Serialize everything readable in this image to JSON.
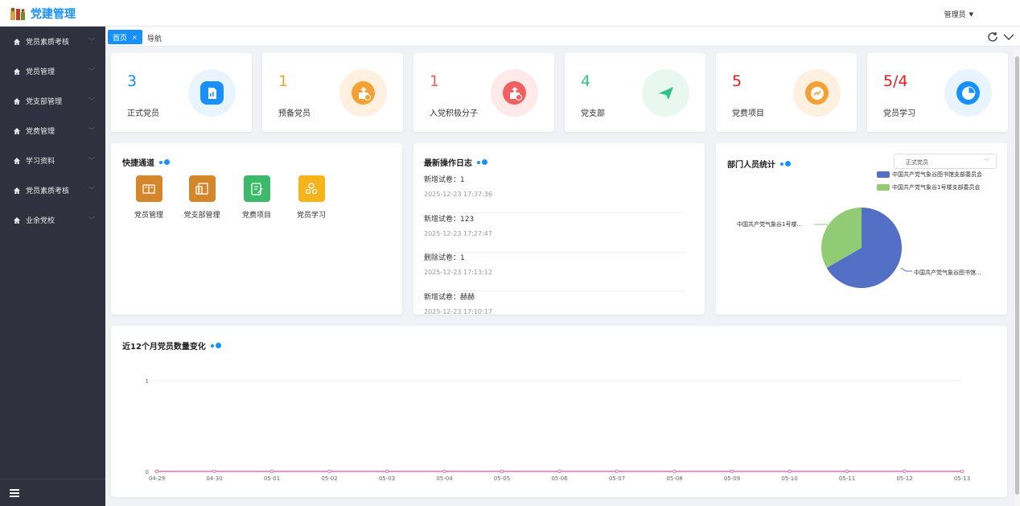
{
  "header": {
    "app_title": "党建管理",
    "user": "管理员"
  },
  "sidebar": {
    "items": [
      {
        "label": "党员素质考核"
      },
      {
        "label": "党员管理"
      },
      {
        "label": "党支部管理"
      },
      {
        "label": "党费管理"
      },
      {
        "label": "学习资料"
      },
      {
        "label": "党员素质考核"
      },
      {
        "label": "业余党校"
      }
    ]
  },
  "tabs": {
    "active": "首页",
    "close": "×",
    "nav": "导航"
  },
  "stats": [
    {
      "value": "3",
      "label": "正式党员",
      "color": "#1890ff",
      "bg": "#e8f4ff",
      "icon_bg": "#1890ff",
      "icon": "chart-doc-icon"
    },
    {
      "value": "1",
      "label": "预备党员",
      "color": "#f5a034",
      "bg": "#fff0df",
      "icon_bg": "#f5a034",
      "icon": "box-upload-icon"
    },
    {
      "value": "1",
      "label": "入党积极分子",
      "color": "#f06060",
      "bg": "#ffe9e9",
      "icon_bg": "#f06060",
      "icon": "box-clock-icon"
    },
    {
      "value": "4",
      "label": "党支部",
      "color": "#35c18a",
      "bg": "#e8f7f0",
      "icon_bg": "#35c18a",
      "icon": "paper-plane-icon"
    },
    {
      "value": "5",
      "label": "党费项目",
      "color": "#e0201f",
      "bg": "#fff0df",
      "icon_bg": "#f5a034",
      "icon": "trend-icon"
    },
    {
      "value": "5/4",
      "label": "党员学习",
      "color": "#e0201f",
      "bg": "#e8f4ff",
      "icon_bg": "#1890ff",
      "icon": "pie-icon"
    }
  ],
  "quick": {
    "title": "快捷通道",
    "items": [
      {
        "label": "党员管理",
        "color": "#d4862a",
        "icon": "book-icon"
      },
      {
        "label": "党支部管理",
        "color": "#d4862a",
        "icon": "list-icon"
      },
      {
        "label": "党费项目",
        "color": "#3cb96a",
        "icon": "edit-icon"
      },
      {
        "label": "党员学习",
        "color": "#f5b31c",
        "icon": "people-icon"
      }
    ]
  },
  "logs": {
    "title": "最新操作日志",
    "items": [
      {
        "text": "新增试卷：1",
        "time": "2025-12-23 17:37:36"
      },
      {
        "text": "新增试卷：123",
        "time": "2025-12-23 17:27:47"
      },
      {
        "text": "删除试卷：1",
        "time": "2025-12-23 17:13:12"
      },
      {
        "text": "新增试卷：赫赫",
        "time": "2025-12-23 17:10:17"
      }
    ]
  },
  "dept": {
    "title": "部门人员统计",
    "select_value": "正式党员",
    "legend": [
      {
        "name": "中国共产党气象谷图书馆支部委员会",
        "color": "#5470c6"
      },
      {
        "name": "中国共产党气象谷1号楼支部委员会",
        "color": "#91cc75"
      }
    ],
    "pie_labels": [
      "中国共产党气象谷1号楼...",
      "中国共产党气象谷图书馆..."
    ],
    "chart_data": {
      "type": "pie",
      "labels": [
        "中国共产党气象谷图书馆支部委员会",
        "中国共产党气象谷1号楼支部委员会"
      ],
      "values": [
        2,
        1
      ]
    }
  },
  "trend": {
    "title": "近12个月党员数量变化",
    "chart_data": {
      "type": "line",
      "x": [
        "04-29",
        "04-30",
        "05-01",
        "05-02",
        "05-03",
        "05-04",
        "05-05",
        "05-06",
        "05-07",
        "05-08",
        "05-09",
        "05-10",
        "05-11",
        "05-12",
        "05-13"
      ],
      "series": [
        {
          "values": [
            0,
            0,
            0,
            0,
            0,
            0,
            0,
            0,
            0,
            0,
            0,
            0,
            0,
            0,
            0
          ],
          "color": "#e66fb5"
        }
      ],
      "ylim": [
        0,
        1
      ],
      "yticks": [
        "0",
        "1"
      ]
    }
  }
}
